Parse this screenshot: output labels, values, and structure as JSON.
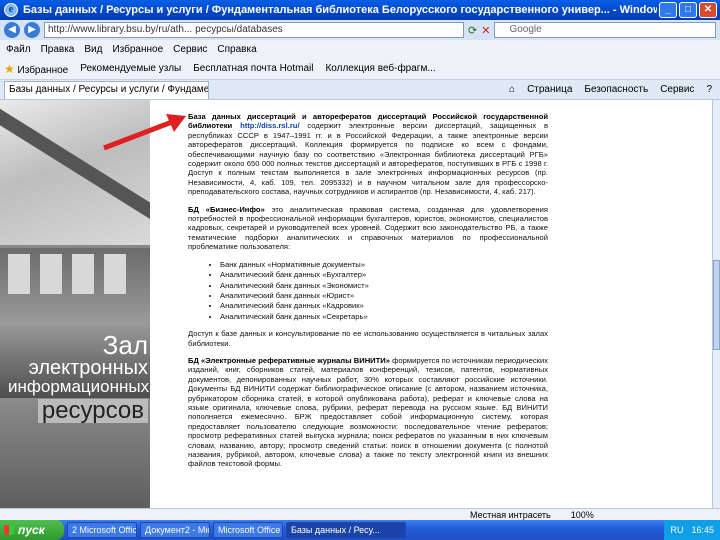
{
  "window": {
    "title": "Базы данных / Ресурсы и услуги / Фундаментальная библиотека Белорусского государственного универ... - Windows Internet Explorer"
  },
  "address": {
    "url": "http://www.library.bsu.by/ru/ath... ресурсы/databases",
    "search_placeholder": "Google"
  },
  "menu": [
    "Файл",
    "Правка",
    "Вид",
    "Избранное",
    "Сервис",
    "Справка"
  ],
  "favorites": {
    "label": "Избранное",
    "links": [
      "Рекомендуемые узлы",
      "Бесплатная почта Hotmail",
      "Коллекция веб-фрагм..."
    ]
  },
  "tab": {
    "label": "Базы данных / Ресурсы и услуги / Фундаментальн..."
  },
  "commandbar": [
    "Страница",
    "Безопасность",
    "Сервис"
  ],
  "sidebar": {
    "hall_line1": "Зал",
    "hall_line2": "электронных",
    "hall_line3": "информационных",
    "hall_line4": "ресурсов"
  },
  "content": {
    "p1_title": "База данных диссертаций и авторефератов диссертаций Российской государственной библиотеки",
    "p1_link": "http://diss.rsl.ru/",
    "p1_text": "содержит электронные версии диссертаций, защищенных в республиках СССР в 1947–1991 гг. и в Российской Федерации, а также электронные версии авторефератов диссертаций. Коллекция формируется по подписке ко всем с фондами, обеспечивающими научную базу по соответствию «Электронная библиотека диссертаций РГБ» содержит около 650 000 полных текстов диссертаций и авторефератов, поступивших в РГБ с 1998 г. Доступ к полным текстам выполняется в зале электронных информационных ресурсов (пр. Независимости, 4, каб. 109, тел. 2095332) и в научном читальном зале для профессорско-преподавательского состава, научных сотрудников и аспирантов (пр. Независимости, 4, каб. 217).",
    "p2_title": "БД «Бизнес-Инфо»",
    "p2_text": "это аналитическая правовая система, созданная для удовлетворения потребностей в профессиональной информации бухгалтеров, юристов, экономистов, специалистов кадровых, секретарей и руководителей всех уровней. Содержит всю законодательство РБ, а также тематические подборки аналитических и справочных материалов по профессиональной проблематике пользователя:",
    "p2_items": [
      "Банк данных «Нормативные документы»",
      "Аналитический банк данных «Бухгалтер»",
      "Аналитический банк данных «Экономист»",
      "Аналитический банк данных «Юрист»",
      "Аналитический банк данных «Кадровик»",
      "Аналитический банк данных «Секретарь»"
    ],
    "p3_text": "Доступ к базе данных и консультирование по ее использованию осуществляется в читальных залах библиотеки.",
    "p4_title": "БД «Электронные реферативные журналы ВИНИТИ»",
    "p4_text": "формируется по источникам периодических изданий, книг, сборников статей, материалов конференций, тезисов, патентов, нормативных документов, депонированных научных работ, 30% которых составляют российские источники. Документы БД ВИНИТИ содержат библиографическое описание (с автором, названием источника, рубрикатором сборника статей, в которой опубликована работа), реферат и ключевые слова на языке оригинала, ключевые слова, рубрики, реферат перевода на русском языке. БД ВИНИТИ пополняется ежемесячно. БРЖ предоставляет собой информационную систему, которая предоставляет пользователю следующие возможности: последовательное чтение рефератов; просмотр реферативных статей выпуска журнала; поиск рефератов по указанным в них ключевым словам, названию, автору; просмотр сведений статьи: поиск в отношении документа (с полнотой названия, рубрикой, автором, ключевые слова) а также по тексту электронной книги из внешних файлов текстовой формы."
  },
  "status": {
    "zone": "Местная интрасеть",
    "zoom": "100%"
  },
  "taskbar": {
    "start": "пуск",
    "items": [
      "2 Microsoft Office ...",
      "Документ2 - Micr...",
      "Microsoft Office ...",
      "Базы данных / Ресу..."
    ],
    "tray": [
      "RU",
      "16:45"
    ]
  }
}
